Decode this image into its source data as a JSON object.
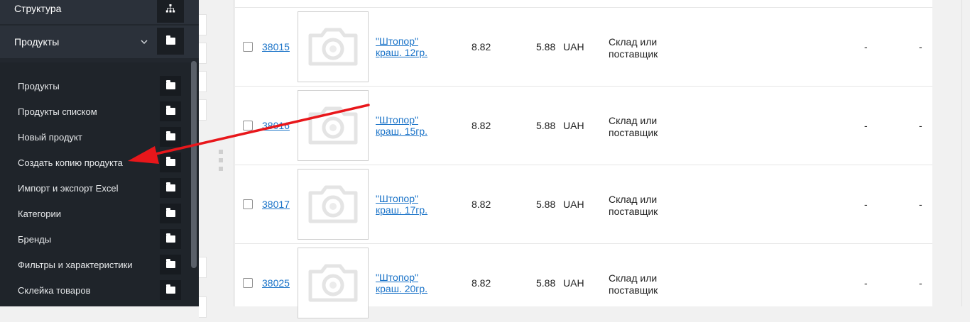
{
  "sidebar": {
    "structure_label": "Структура",
    "products_label": "Продукты",
    "structure_icon": "sitemap-icon",
    "products_icon": "folder-icon",
    "items": [
      {
        "label": "Продукты",
        "icon": "folder-icon"
      },
      {
        "label": "Продукты списком",
        "icon": "folder-icon"
      },
      {
        "label": "Новый продукт",
        "icon": "folder-icon"
      },
      {
        "label": "Создать копию продукта",
        "icon": "folder-icon"
      },
      {
        "label": "Импорт и экспорт Excel",
        "icon": "folder-icon"
      },
      {
        "label": "Категории",
        "icon": "folder-icon"
      },
      {
        "label": "Бренды",
        "icon": "folder-icon"
      },
      {
        "label": "Фильтры и характеристики",
        "icon": "folder-icon"
      },
      {
        "label": "Склейка товаров",
        "icon": "folder-icon"
      }
    ]
  },
  "table": {
    "rows": [
      {
        "id": "38015",
        "name_line1": "\"Штопор\"",
        "name_line2": "краш. 12гр.",
        "price": "8.82",
        "price2": "5.88",
        "currency": "UAH",
        "stock_line1": "Склад или",
        "stock_line2": "поставщик",
        "col_a": "-",
        "col_b": "-"
      },
      {
        "id": "38016",
        "name_line1": "\"Штопор\"",
        "name_line2": "краш. 15гр.",
        "price": "8.82",
        "price2": "5.88",
        "currency": "UAH",
        "stock_line1": "Склад или",
        "stock_line2": "поставщик",
        "col_a": "-",
        "col_b": "-"
      },
      {
        "id": "38017",
        "name_line1": "\"Штопор\"",
        "name_line2": "краш. 17гр.",
        "price": "8.82",
        "price2": "5.88",
        "currency": "UAH",
        "stock_line1": "Склад или",
        "stock_line2": "поставщик",
        "col_a": "-",
        "col_b": "-"
      },
      {
        "id": "38025",
        "name_line1": "\"Штопор\"",
        "name_line2": "краш. 20гр.",
        "price": "8.82",
        "price2": "5.88",
        "currency": "UAH",
        "stock_line1": "Склад или",
        "stock_line2": "поставщик",
        "col_a": "-",
        "col_b": "-"
      }
    ]
  },
  "colors": {
    "sidebar_bg": "#22272e",
    "link": "#1a73c8",
    "annotation_arrow": "#e8171b"
  }
}
